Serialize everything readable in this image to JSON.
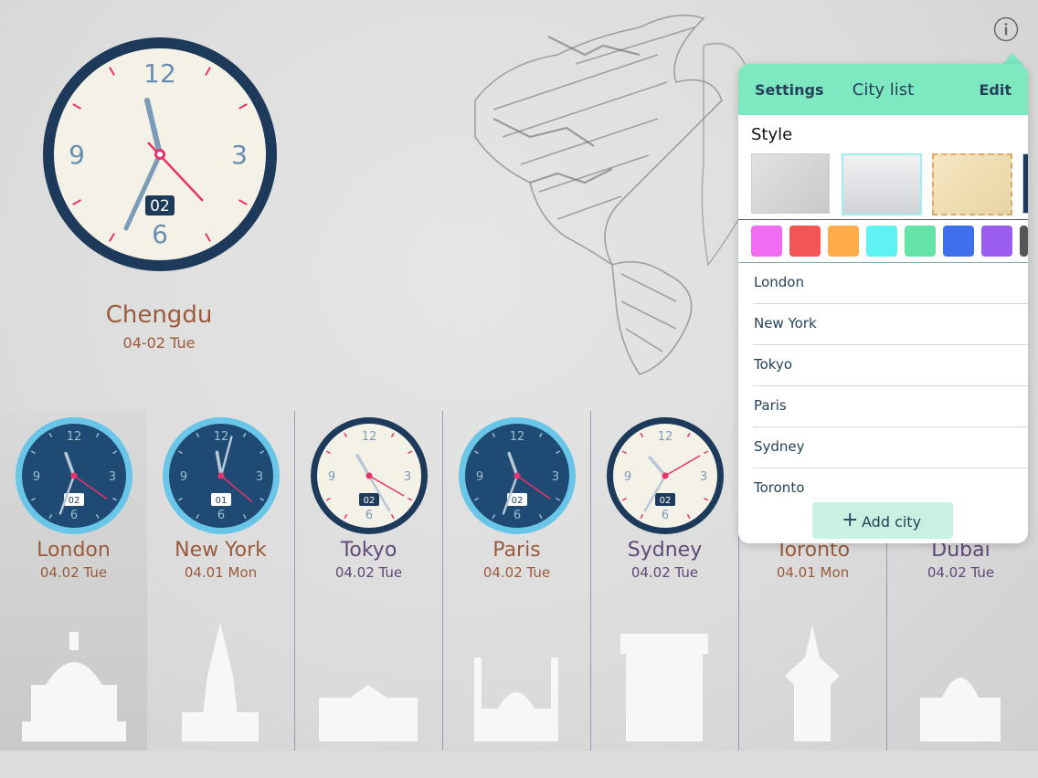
{
  "main": {
    "city": "Chengdu",
    "date": "04-02 Tue",
    "date_badge": "02",
    "numerals": [
      "12",
      "3",
      "6",
      "9"
    ]
  },
  "cities": [
    {
      "name": "London",
      "date": "04.02 Tue",
      "badge": "02",
      "face": "dark",
      "color": "#9a5a3c"
    },
    {
      "name": "New York",
      "date": "04.01 Mon",
      "badge": "01",
      "face": "dark",
      "color": "#9a5a3c"
    },
    {
      "name": "Tokyo",
      "date": "04.02 Tue",
      "badge": "02",
      "face": "light",
      "color": "#5e4a78"
    },
    {
      "name": "Paris",
      "date": "04.02 Tue",
      "badge": "02",
      "face": "dark",
      "color": "#9a5a3c"
    },
    {
      "name": "Sydney",
      "date": "04.02 Tue",
      "badge": "02",
      "face": "light",
      "color": "#5e4a78"
    },
    {
      "name": "Toronto",
      "date": "04.01 Mon",
      "badge": "",
      "face": "none",
      "color": "#9a5a3c"
    },
    {
      "name": "Dubai",
      "date": "04.02 Tue",
      "badge": "",
      "face": "none",
      "color": "#5e4a78"
    }
  ],
  "popover": {
    "settings": "Settings",
    "title": "City list",
    "edit": "Edit",
    "style_label": "Style",
    "swatches": [
      "#f06cf0",
      "#f45454",
      "#ffad4a",
      "#5ef2f2",
      "#63e3a8",
      "#3f6fea",
      "#9b5cf0"
    ],
    "cities": [
      "London",
      "New York",
      "Tokyo",
      "Paris",
      "Sydney",
      "Toronto"
    ],
    "add_city": "Add city"
  },
  "colors": {
    "accent": "#7ee8c0",
    "navy": "#25425a",
    "hand_red": "#e8336b"
  }
}
